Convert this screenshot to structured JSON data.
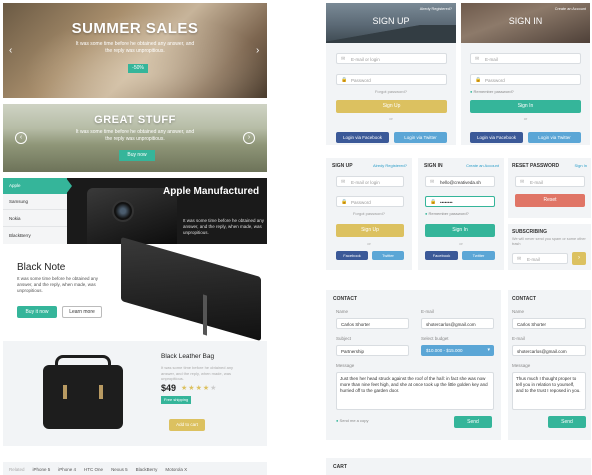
{
  "summer": {
    "title": "SUMMER SALES",
    "text": "It was some time before he obtained any answer, and the reply was unpropitious.",
    "badge": "-50%"
  },
  "great": {
    "title": "GREAT STUFF",
    "text": "It was some time before he obtained any answer, and the reply was unpropitious.",
    "button": "Buy now"
  },
  "apple": {
    "tabs": [
      "Apple",
      "Samsung",
      "Nokia",
      "BlackBerry"
    ],
    "title": "Apple Manufactured",
    "text": "It was some time before he obtained any answer, and the reply, when made, was unpropitious."
  },
  "note": {
    "title": "Black Note",
    "text": "It was some time before he obtained any answer, and the reply, when made, was unpropitious.",
    "buy": "Buy it now",
    "learn": "Learn more"
  },
  "bag": {
    "title": "Black Leather Bag",
    "text": "It was some time before he obtained any answer, and the reply, when made, was unpropitious.",
    "price": "$49",
    "stars": 5,
    "rating": 4,
    "shipping": "Free shipping",
    "cart": "Add to cart"
  },
  "bottom_tabs": [
    "Related",
    "iPhone 5",
    "iPhone 4",
    "HTC One",
    "Nexus 5",
    "BlackBerry",
    "Motorola X"
  ],
  "signup_top": {
    "title": "SIGN UP",
    "link": "Alredy Registered?",
    "email": "E-mail or login",
    "password": "Password",
    "forgot": "Forgot password?",
    "btn": "Sign Up",
    "or": "or",
    "fb": "Login via Facebook",
    "tw": "Login via Twitter"
  },
  "signin_top": {
    "title": "SIGN IN",
    "link": "Create an Account",
    "email": "E-mail",
    "password": "Password",
    "remember": "Remember password?",
    "btn": "Sign In",
    "or": "or",
    "fb": "Login via Facebook",
    "tw": "Login via Twitter"
  },
  "signup_small": {
    "title": "SIGN UP",
    "link": "Alredy Registered?",
    "email": "E-mail or login",
    "password": "Password",
    "forgot": "Forgot password?",
    "btn": "Sign Up",
    "or": "or",
    "fb": "Facebook",
    "tw": "Twitter"
  },
  "signin_small": {
    "title": "SIGN IN",
    "link": "Create an Account",
    "email": "hello@creativeda.sh",
    "password": "••••••••",
    "remember": "Remember password?",
    "btn": "Sign In",
    "or": "or",
    "fb": "Facebook",
    "tw": "Twitter"
  },
  "reset": {
    "title": "RESET PASSWORD",
    "link": "Sign In",
    "email": "E-mail",
    "btn": "Reset"
  },
  "subscribe": {
    "title": "SUBSCRIBING",
    "text": "We will never send you spam or some other trash",
    "email": "E-mail"
  },
  "contact": {
    "title": "CONTACT",
    "name_label": "Name",
    "name": "Carlos Shorter",
    "email_label": "E-mail",
    "email": "shotercarlos@gmail.com",
    "subject_label": "Subject",
    "subject": "Partnership",
    "budget_label": "Select budget",
    "budget": "$10.000 - $15.000",
    "message_label": "Message",
    "message": "Just then her head struck against the roof of the hall: in fact she was now more than nine feet high, and she at once took up the little golden key and hurried off to the garden door.",
    "copy": "Send me a copy",
    "send": "Send"
  },
  "contact2": {
    "title": "CONTACT",
    "name_label": "Name",
    "name": "Carlos Shorter",
    "email_label": "E-mail",
    "email": "shotercarlos@gmail.com",
    "message_label": "Message",
    "message": "Thus much I thought proper to tell you in relation to yourself, and to the trust I reposed in you.",
    "send": "Send"
  },
  "cart": {
    "title": "CART"
  },
  "colors": {
    "teal": "#35b59a",
    "yellow": "#dcc160",
    "fb": "#3b5998",
    "tw": "#5ba6d6",
    "red": "#e07566"
  }
}
